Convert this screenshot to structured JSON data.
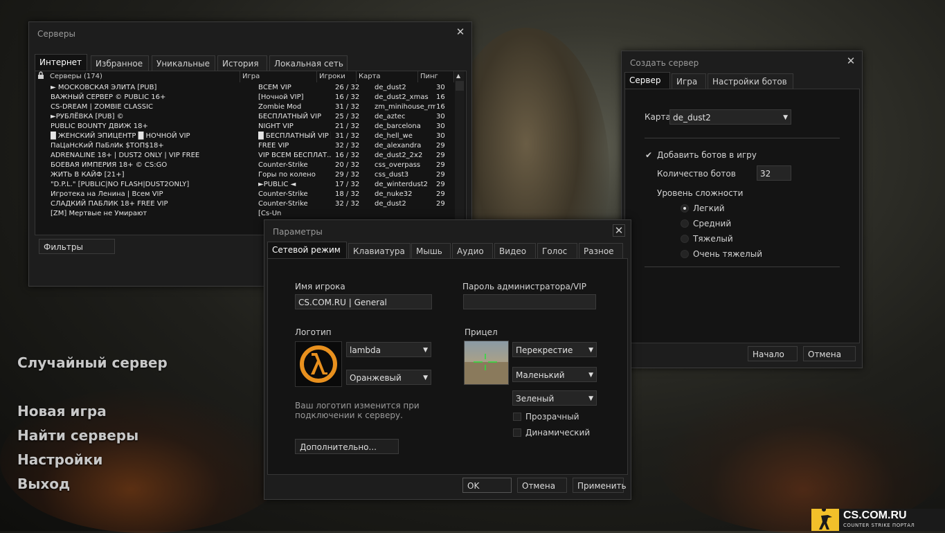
{
  "main_menu": {
    "random_server": "Случайный сервер",
    "new_game": "Новая игра",
    "find_servers": "Найти серверы",
    "settings": "Настройки",
    "exit": "Выход"
  },
  "servers": {
    "title": "Серверы",
    "tabs": [
      "Интернет",
      "Избранное",
      "Уникальные",
      "История",
      "Локальная сеть"
    ],
    "columns": {
      "servers": "Серверы (174)",
      "game": "Игра",
      "players": "Игроки",
      "map": "Карта",
      "ping": "Пинг"
    },
    "rows": [
      {
        "name": "► МОСКОВСКАЯ ЭЛИТА [PUB]",
        "game": "ВСЕМ VIP",
        "players": "26 / 32",
        "map": "de_dust2",
        "ping": "30"
      },
      {
        "name": "ВАЖНЫЙ СЕРВЕР © PUBLIC 16+",
        "game": "[Ночной VIP]",
        "players": "16 / 32",
        "map": "de_dust2_xmas",
        "ping": "16"
      },
      {
        "name": "CS-DREAM | ZOMBIE CLASSIC",
        "game": "Zombie Mod",
        "players": "31 / 32",
        "map": "zm_minihouse_rmk",
        "ping": "16"
      },
      {
        "name": "►РУБЛЁВКА [PUB] ©",
        "game": "БЕСПЛАТНЫЙ VIP",
        "players": "25 / 32",
        "map": "de_aztec",
        "ping": "30"
      },
      {
        "name": "PUBLIC BOUNTY ДВИЖ 18+",
        "game": "NIGHT VIP",
        "players": "21 / 32",
        "map": "de_barcelona",
        "ping": "30"
      },
      {
        "name": "█ ЖЕНСКИЙ ЭПИЦЕНТР █ НОЧНОЙ VIP",
        "game": "█ БЕСПЛАТНЫЙ VIP █",
        "players": "31 / 32",
        "map": "de_hell_we",
        "ping": "30"
      },
      {
        "name": "ПаЦаНсКиЙ ПаБлИк $ТОП$18+",
        "game": "FREE VIP",
        "players": "32 / 32",
        "map": "de_alexandra",
        "ping": "29"
      },
      {
        "name": "ADRENALINE 18+ | DUST2 ONLY | VIP FREE",
        "game": "VIP ВСЕМ БЕСПЛАТ...",
        "players": "16 / 32",
        "map": "de_dust2_2x2",
        "ping": "29"
      },
      {
        "name": "БОЕВАЯ ИМПЕРИЯ 18+ © CS:GO",
        "game": "Counter-Strike",
        "players": "20 / 32",
        "map": "css_overpass",
        "ping": "29"
      },
      {
        "name": "ЖИТЬ В КАЙФ [21+]",
        "game": "Горы по колено",
        "players": "29 / 32",
        "map": "css_dust3",
        "ping": "29"
      },
      {
        "name": "\"D.P.L.\" [PUBLIC|NO FLASH|DUST2ONLY]",
        "game": "►PUBLIC ◄",
        "players": "17 / 32",
        "map": "de_winterdust2",
        "ping": "29"
      },
      {
        "name": "Игротека на Ленина | Всем VIP",
        "game": "Counter-Strike",
        "players": "18 / 32",
        "map": "de_nuke32",
        "ping": "29"
      },
      {
        "name": "СЛАДКИЙ ПАБЛИК 18+ FREE VIP",
        "game": "Counter-Strike",
        "players": "32 / 32",
        "map": "de_dust2",
        "ping": "29"
      },
      {
        "name": "[ZM] Мертвые не Умирают",
        "game": "[Cs-Un",
        "players": "",
        "map": "",
        "ping": ""
      }
    ],
    "filters_button": "Фильтры"
  },
  "create_server": {
    "title": "Создать сервер",
    "tabs": [
      "Сервер",
      "Игра",
      "Настройки ботов"
    ],
    "map_label": "Карта",
    "map_value": "de_dust2",
    "add_bots_label": "Добавить ботов в игру",
    "bot_count_label": "Количество ботов",
    "bot_count_value": "32",
    "difficulty_label": "Уровень сложности",
    "difficulties": [
      "Легкий",
      "Средний",
      "Тяжелый",
      "Очень тяжелый"
    ],
    "selected_difficulty": 0,
    "start_button": "Начало",
    "cancel_button": "Отмена"
  },
  "params": {
    "title": "Параметры",
    "tabs": [
      "Сетевой режим",
      "Клавиатура",
      "Мышь",
      "Аудио",
      "Видео",
      "Голос",
      "Разное"
    ],
    "player_name_label": "Имя игрока",
    "player_name_value": "CS.COM.RU | General",
    "admin_password_label": "Пароль администратора/VIP",
    "admin_password_value": "",
    "logo_label": "Логотип",
    "logo_select": "lambda",
    "logo_color_select": "Оранжевый",
    "logo_note": "Ваш логотип изменится при подключении к серверу.",
    "crosshair_label": "Прицел",
    "crosshair_type": "Перекрестие",
    "crosshair_size": "Маленький",
    "crosshair_color": "Зеленый",
    "transparent_label": "Прозрачный",
    "dynamic_label": "Динамический",
    "advanced_button": "Дополнительно...",
    "ok_button": "OK",
    "cancel_button": "Отмена",
    "apply_button": "Применить"
  },
  "brand": {
    "site": "CS.COM.RU",
    "tagline": "COUNTER STRIKE ПОРТАЛ"
  },
  "colors": {
    "accent_orange": "#e8901e",
    "crosshair_green": "#2adf3a",
    "logo_yellow": "#f2c02a"
  }
}
